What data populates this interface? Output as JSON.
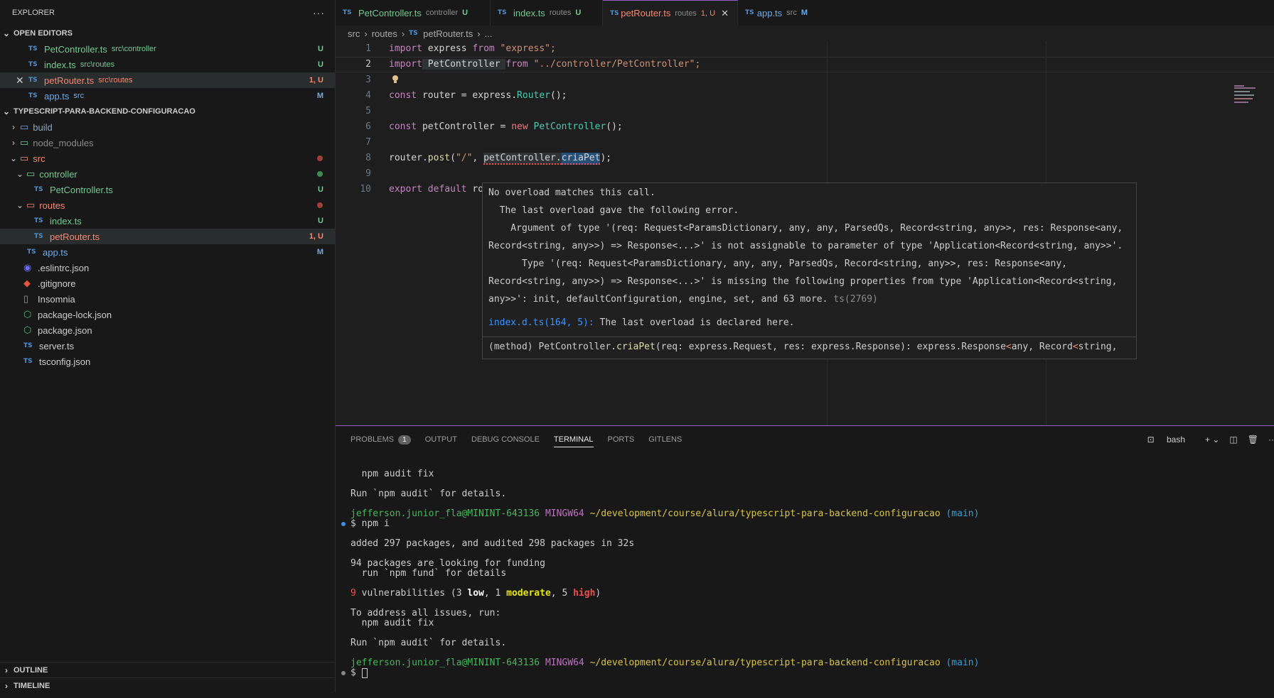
{
  "explorer": {
    "title": "EXPLORER",
    "open_editors_label": "OPEN EDITORS",
    "open_editors": [
      {
        "name": "PetController.ts",
        "path": "src\\controller",
        "badge": "U"
      },
      {
        "name": "index.ts",
        "path": "src\\routes",
        "badge": "U"
      },
      {
        "name": "petRouter.ts",
        "path": "src\\routes",
        "badge": "1, U"
      },
      {
        "name": "app.ts",
        "path": "src",
        "badge": "M"
      }
    ],
    "project_label": "TYPESCRIPT-PARA-BACKEND-CONFIGURACAO",
    "tree": {
      "build": "build",
      "node_modules": "node_modules",
      "src": "src",
      "controller": "controller",
      "pet_controller": "PetController.ts",
      "pet_controller_badge": "U",
      "routes": "routes",
      "index": "index.ts",
      "index_badge": "U",
      "pet_router": "petRouter.ts",
      "pet_router_badge": "1, U",
      "app": "app.ts",
      "app_badge": "M",
      "eslintrc": ".eslintrc.json",
      "gitignore": ".gitignore",
      "insomnia": "Insomnia",
      "package_lock": "package-lock.json",
      "package": "package.json",
      "server": "server.ts",
      "tsconfig": "tsconfig.json"
    },
    "outline_label": "OUTLINE",
    "timeline_label": "TIMELINE"
  },
  "tabs": [
    {
      "name": "PetController.ts",
      "desc": "controller",
      "badge": "U"
    },
    {
      "name": "index.ts",
      "desc": "routes",
      "badge": "U"
    },
    {
      "name": "petRouter.ts",
      "desc": "routes",
      "badge": "1, U"
    },
    {
      "name": "app.ts",
      "desc": "src",
      "badge": "M"
    }
  ],
  "breadcrumb": {
    "a": "src",
    "b": "routes",
    "c": "petRouter.ts",
    "d": "..."
  },
  "code": {
    "l1": {
      "a": "import",
      "b": " express ",
      "c": "from",
      "d": " \"express\";"
    },
    "l2": {
      "a": "import",
      "b": " PetController ",
      "c": "from",
      "d": " \"../controller/PetController\";"
    },
    "l4": {
      "a": "const",
      "b": " router ",
      "c": "= express.",
      "d": "Router",
      "e": "();"
    },
    "l6": {
      "a": "const",
      "b": " petController ",
      "c": "= ",
      "d": "new",
      "e": " PetController",
      "f": "();"
    },
    "l8": {
      "a": "router.",
      "b": "post",
      "c": "(",
      "d": "\"/\"",
      "e": ", ",
      "f": "petController.",
      "g": "criaPet",
      "h": ");"
    },
    "l10": {
      "a": "export",
      "b": " default",
      "c": " ro"
    }
  },
  "hover": {
    "l1": "No overload matches this call.",
    "l2": "  The last overload gave the following error.",
    "l3": "    Argument of type '(req: Request<ParamsDictionary, any, any, ParsedQs, Record<string, any>>, res: Response<any,",
    "l4": "Record<string, any>>) => Response<...>' is not assignable to parameter of type 'Application<Record<string, any>>'.",
    "l5": "      Type '(req: Request<ParamsDictionary, any, any, ParsedQs, Record<string, any>>, res: Response<any,",
    "l6": "Record<string, any>>) => Response<...>' is missing the following properties from type 'Application<Record<string,",
    "l7": "any>>': init, defaultConfiguration, engine, set, and 63 more.",
    "l7_code": "ts(2769)",
    "l8_link": "index.d.ts(164, 5):",
    "l8_text": " The last overload is declared here.",
    "sig_a": "(method) PetController.",
    "sig_b": "criaPet",
    "sig_c": "(req: express.Request, res: express.Response): express.Response",
    "sig_d": "<",
    "sig_e": "any, Record",
    "sig_f": "<",
    "sig_g": "string,"
  },
  "panel": {
    "problems": "PROBLEMS",
    "problems_count": "1",
    "output": "OUTPUT",
    "debug": "DEBUG CONSOLE",
    "terminal": "TERMINAL",
    "ports": "PORTS",
    "gitlens": "GITLENS",
    "shell": "bash"
  },
  "terminal": {
    "t1": "  npm audit fix",
    "t2": "Run `npm audit` for details.",
    "user": "jefferson.junior_fla@MININT-643136",
    "mingw": "MINGW64",
    "path": "~/development/course/alura/typescript-para-backend-configuracao",
    "branch": "(main)",
    "cmd": "$ npm i",
    "t5": "added 297 packages, and audited 298 packages in 32s",
    "t6": "94 packages are looking for funding",
    "t7": "  run `npm fund` for details",
    "v_count": "9",
    "v_a": " vulnerabilities (3 ",
    "v_low": "low",
    "v_b": ", 1 ",
    "v_mod": "moderate",
    "v_c": ", 5 ",
    "v_high": "high",
    "v_d": ")",
    "t9": "To address all issues, run:",
    "t10": "  npm audit fix",
    "t11": "Run `npm audit` for details.",
    "prompt": "$ "
  }
}
